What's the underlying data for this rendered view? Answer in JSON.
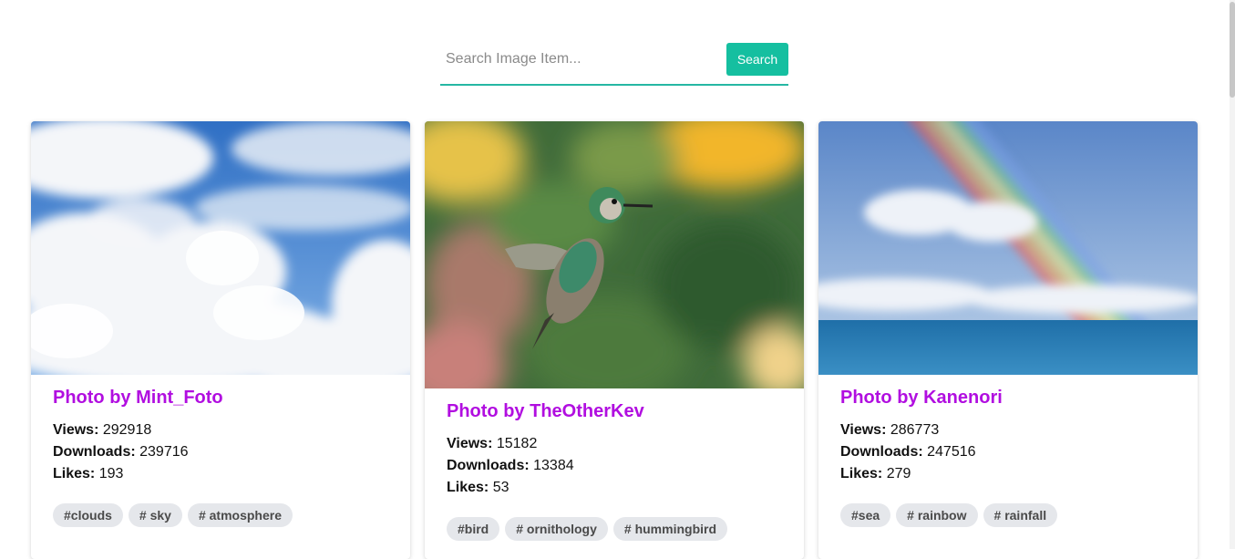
{
  "search": {
    "placeholder": "Search Image Item...",
    "button_label": "Search"
  },
  "cards": [
    {
      "title": "Photo by Mint_Foto",
      "views_label": "Views:",
      "views": "292918",
      "downloads_label": "Downloads:",
      "downloads": "239716",
      "likes_label": "Likes:",
      "likes": "193",
      "tags": [
        "#clouds",
        "# sky",
        "# atmosphere"
      ],
      "image_icon": "clouds-sky-image"
    },
    {
      "title": "Photo by TheOtherKev",
      "views_label": "Views:",
      "views": "15182",
      "downloads_label": "Downloads:",
      "downloads": "13384",
      "likes_label": "Likes:",
      "likes": "53",
      "tags": [
        "#bird",
        "# ornithology",
        "# hummingbird"
      ],
      "image_icon": "hummingbird-image"
    },
    {
      "title": "Photo by Kanenori",
      "views_label": "Views:",
      "views": "286773",
      "downloads_label": "Downloads:",
      "downloads": "247516",
      "likes_label": "Likes:",
      "likes": "279",
      "tags": [
        "#sea",
        "# rainbow",
        "# rainfall"
      ],
      "image_icon": "rainbow-sea-image"
    }
  ],
  "colors": {
    "accent": "#15bfa0",
    "title": "#b10ee0",
    "tag_bg": "#e5e7eb"
  }
}
